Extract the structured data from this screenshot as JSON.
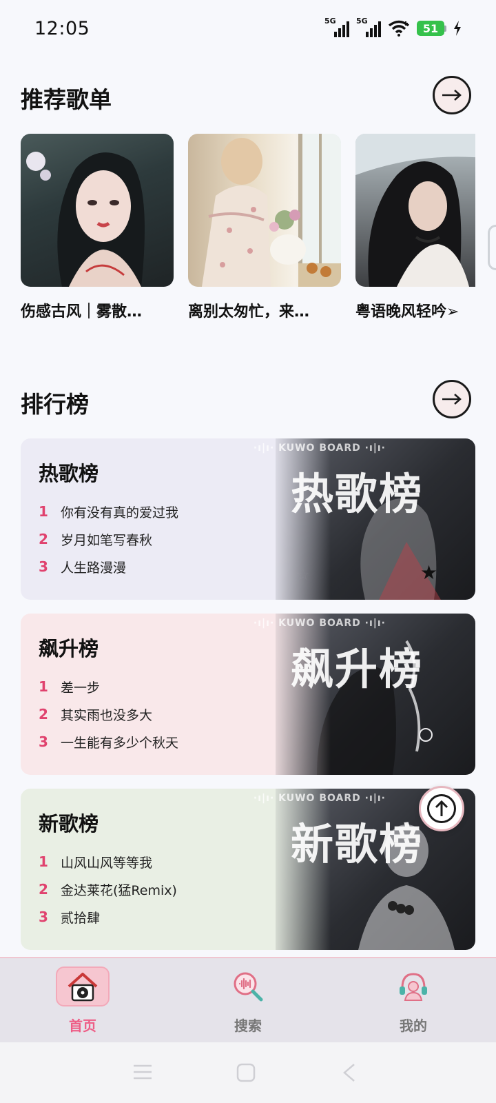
{
  "status_bar": {
    "time": "12:05",
    "sim1": "5G",
    "sim2": "5G",
    "battery": "51",
    "icons": [
      "signal-icon",
      "signal-icon",
      "wifi-icon",
      "battery-icon",
      "charging-icon"
    ]
  },
  "recommend": {
    "title": "推荐歌单",
    "more_icon": "arrow-right-icon",
    "playlists": [
      {
        "name": "伤感古风｜雾散…"
      },
      {
        "name": "离别太匆忙，来…"
      },
      {
        "name": "粤语晚风轻吟➢"
      }
    ]
  },
  "charts": {
    "title": "排行榜",
    "more_icon": "arrow-right-icon",
    "brand": "·ı|ı· KUWO BOARD ·ı|ı·",
    "cards": [
      {
        "name": "热歌榜",
        "art_title": "热歌榜",
        "songs": [
          {
            "rank": "1",
            "title": "你有没有真的爱过我"
          },
          {
            "rank": "2",
            "title": "岁月如笔写春秋"
          },
          {
            "rank": "3",
            "title": "人生路漫漫"
          }
        ]
      },
      {
        "name": "飙升榜",
        "art_title": "飙升榜",
        "songs": [
          {
            "rank": "1",
            "title": "差一步"
          },
          {
            "rank": "2",
            "title": "其实雨也没多大"
          },
          {
            "rank": "3",
            "title": "一生能有多少个秋天"
          }
        ]
      },
      {
        "name": "新歌榜",
        "art_title": "新歌榜",
        "songs": [
          {
            "rank": "1",
            "title": "山风山风等等我"
          },
          {
            "rank": "2",
            "title": "金达莱花(猛Remix)"
          },
          {
            "rank": "3",
            "title": "贰拾肆"
          }
        ]
      }
    ]
  },
  "tabbar": {
    "tabs": [
      {
        "label": "首页",
        "icon": "home-icon",
        "active": true
      },
      {
        "label": "搜索",
        "icon": "search-icon",
        "active": false
      },
      {
        "label": "我的",
        "icon": "headset-user-icon",
        "active": false
      }
    ]
  },
  "colors": {
    "accent": "#ee5d86",
    "rank": "#e0426e",
    "background": "#f7f8fc"
  }
}
